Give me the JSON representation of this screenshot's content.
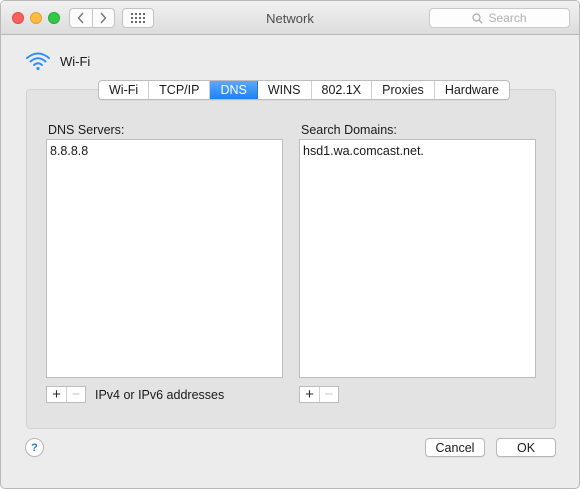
{
  "window": {
    "title": "Network"
  },
  "toolbar": {
    "search_placeholder": "Search"
  },
  "interface": {
    "name": "Wi-Fi"
  },
  "tabs": [
    {
      "label": "Wi-Fi",
      "active": false
    },
    {
      "label": "TCP/IP",
      "active": false
    },
    {
      "label": "DNS",
      "active": true
    },
    {
      "label": "WINS",
      "active": false
    },
    {
      "label": "802.1X",
      "active": false
    },
    {
      "label": "Proxies",
      "active": false
    },
    {
      "label": "Hardware",
      "active": false
    }
  ],
  "dns": {
    "servers_label": "DNS Servers:",
    "servers": [
      "8.8.8.8"
    ],
    "domains_label": "Search Domains:",
    "domains": [
      "hsd1.wa.comcast.net."
    ],
    "hint": "IPv4 or IPv6 addresses",
    "add_symbol": "+",
    "remove_symbol": "−"
  },
  "footer": {
    "help_symbol": "?",
    "cancel_label": "Cancel",
    "ok_label": "OK"
  },
  "colors": {
    "accent": "#1a82fb",
    "close": "#fc605c",
    "minimize": "#fdbc40",
    "zoom": "#34c84a"
  }
}
